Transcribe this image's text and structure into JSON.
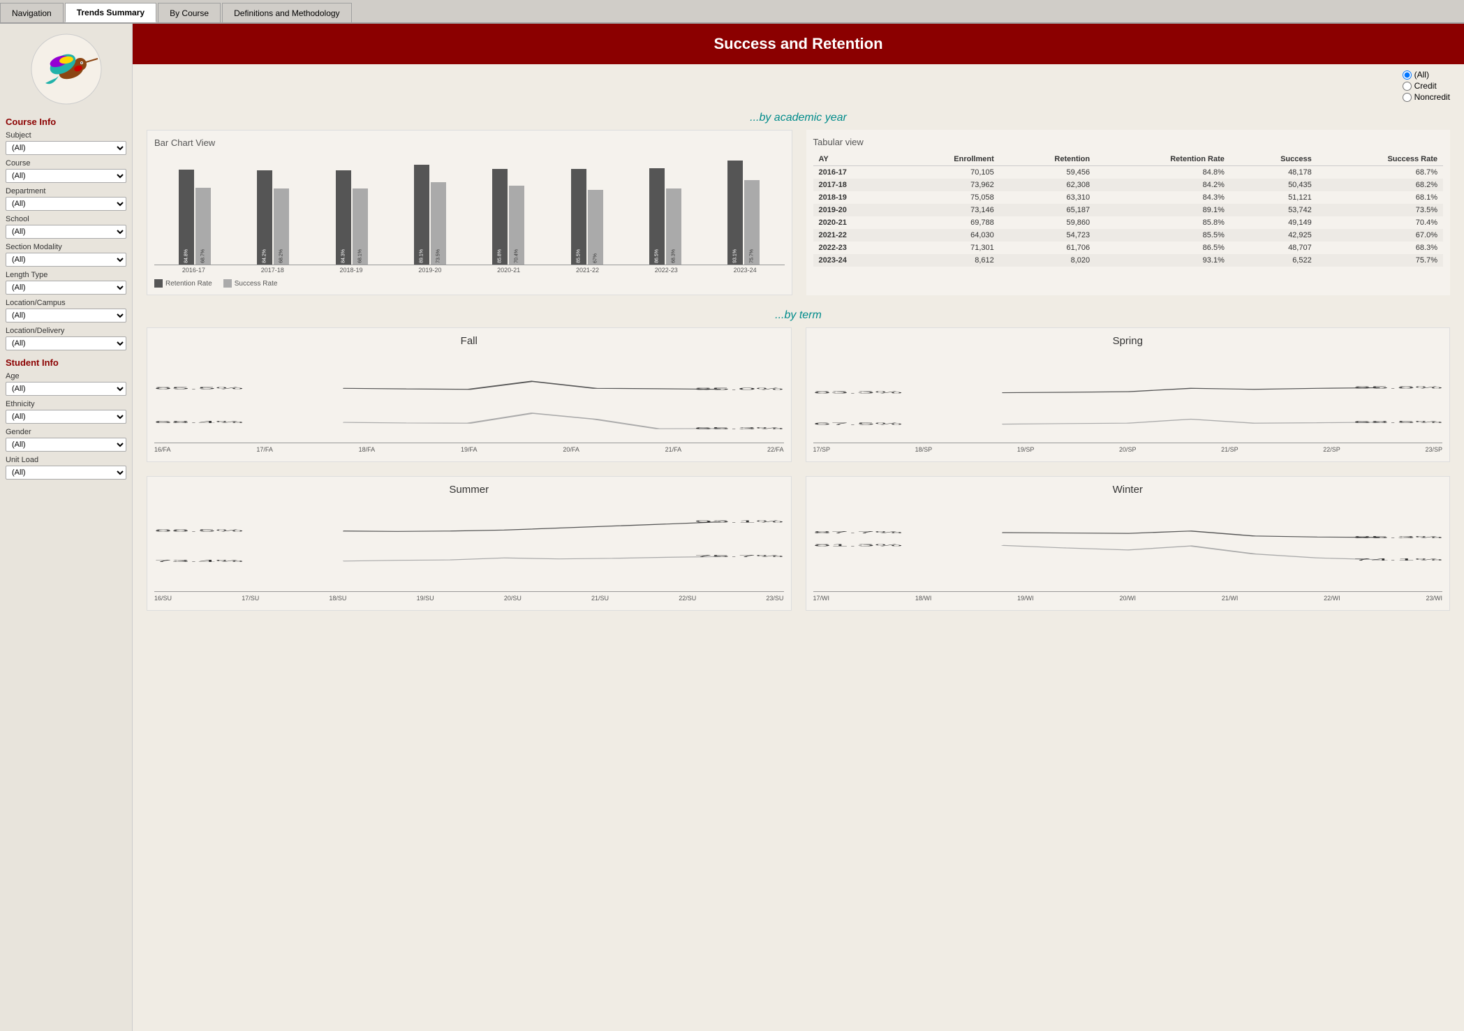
{
  "tabs": [
    {
      "label": "Navigation",
      "active": false
    },
    {
      "label": "Trends Summary",
      "active": true
    },
    {
      "label": "By Course",
      "active": false
    },
    {
      "label": "Definitions and Methodology",
      "active": false
    }
  ],
  "header": {
    "title": "Success and Retention"
  },
  "filter": {
    "options": [
      "(All)",
      "Credit",
      "Noncredit"
    ],
    "selected": "(All)"
  },
  "sidebar": {
    "course_info_title": "Course Info",
    "student_info_title": "Student Info",
    "filters": [
      {
        "label": "Subject",
        "default": "(All)"
      },
      {
        "label": "Course",
        "default": "(All)"
      },
      {
        "label": "Department",
        "default": "(All)"
      },
      {
        "label": "School",
        "default": "(All)"
      },
      {
        "label": "Section Modality",
        "default": "(All)"
      },
      {
        "label": "Length Type",
        "default": "(All)"
      },
      {
        "label": "Location/Campus",
        "default": "(All)"
      },
      {
        "label": "Location/Delivery",
        "default": "(All)"
      }
    ],
    "student_filters": [
      {
        "label": "Age",
        "default": "(All)"
      },
      {
        "label": "Ethnicity",
        "default": "(All)"
      },
      {
        "label": "Gender",
        "default": "(All)"
      },
      {
        "label": "Unit Load",
        "default": "(All)"
      }
    ]
  },
  "by_academic_year": {
    "section_title": "...by academic year",
    "bar_chart_title": "Bar Chart View",
    "tabular_title": "Tabular view",
    "years": [
      "2016-17",
      "2017-18",
      "2018-19",
      "2019-20",
      "2020-21",
      "2021-22",
      "2022-23",
      "2023-24"
    ],
    "retention_rates": [
      84.8,
      84.2,
      84.3,
      89.1,
      85.8,
      85.5,
      86.5,
      93.1
    ],
    "success_rates": [
      68.7,
      68.2,
      68.1,
      73.5,
      70.4,
      67.0,
      68.3,
      75.7
    ],
    "table_rows": [
      {
        "ay": "2016-17",
        "enrollment": "70,105",
        "retention": "59,456",
        "retention_rate": "84.8%",
        "success": "48,178",
        "success_rate": "68.7%"
      },
      {
        "ay": "2017-18",
        "enrollment": "73,962",
        "retention": "62,308",
        "retention_rate": "84.2%",
        "success": "50,435",
        "success_rate": "68.2%"
      },
      {
        "ay": "2018-19",
        "enrollment": "75,058",
        "retention": "63,310",
        "retention_rate": "84.3%",
        "success": "51,121",
        "success_rate": "68.1%"
      },
      {
        "ay": "2019-20",
        "enrollment": "73,146",
        "retention": "65,187",
        "retention_rate": "89.1%",
        "success": "53,742",
        "success_rate": "73.5%"
      },
      {
        "ay": "2020-21",
        "enrollment": "69,788",
        "retention": "59,860",
        "retention_rate": "85.8%",
        "success": "49,149",
        "success_rate": "70.4%"
      },
      {
        "ay": "2021-22",
        "enrollment": "64,030",
        "retention": "54,723",
        "retention_rate": "85.5%",
        "success": "42,925",
        "success_rate": "67.0%"
      },
      {
        "ay": "2022-23",
        "enrollment": "71,301",
        "retention": "61,706",
        "retention_rate": "86.5%",
        "success": "48,707",
        "success_rate": "68.3%"
      },
      {
        "ay": "2023-24",
        "enrollment": "8,612",
        "retention": "8,020",
        "retention_rate": "93.1%",
        "success": "6,522",
        "success_rate": "75.7%"
      }
    ],
    "table_headers": [
      "AY",
      "Enrollment",
      "Retention",
      "Retention Rate",
      "Success",
      "Success Rate"
    ]
  },
  "by_term": {
    "section_title": "...by term",
    "fall": {
      "title": "Fall",
      "labels": [
        "16/FA",
        "17/FA",
        "18/FA",
        "19/FA",
        "20/FA",
        "21/FA",
        "22/FA"
      ],
      "retention": [
        85.5,
        85.2,
        85.0,
        89.0,
        85.5,
        85.3,
        85.0
      ],
      "success": [
        68.4,
        68.1,
        68.0,
        73.0,
        70.0,
        65.2,
        65.3
      ],
      "start_retention": "85.5%",
      "end_retention": "85.0%",
      "start_success": "68.4%",
      "end_success": "65.3%"
    },
    "spring": {
      "title": "Spring",
      "labels": [
        "17/SP",
        "18/SP",
        "19/SP",
        "20/SP",
        "21/SP",
        "22/SP",
        "23/SP"
      ],
      "retention": [
        83.3,
        83.5,
        83.8,
        85.5,
        85.0,
        85.5,
        85.8
      ],
      "success": [
        67.5,
        67.8,
        68.0,
        70.0,
        68.0,
        68.2,
        68.5
      ],
      "start_retention": "83.3%",
      "end_retention": "85.8%",
      "start_success": "67.5%",
      "end_success": "68.5%"
    },
    "summer": {
      "title": "Summer",
      "labels": [
        "16/SU",
        "17/SU",
        "18/SU",
        "19/SU",
        "20/SU",
        "21/SU",
        "22/SU",
        "23/SU"
      ],
      "retention": [
        88.5,
        88.3,
        88.5,
        89.0,
        90.0,
        91.0,
        92.0,
        93.1
      ],
      "success": [
        73.4,
        73.8,
        74.0,
        75.0,
        74.5,
        74.8,
        75.3,
        75.7
      ],
      "start_retention": "88.5%",
      "end_retention": "93.1%",
      "start_success": "73.4%",
      "end_success": "75.7%"
    },
    "winter": {
      "title": "Winter",
      "labels": [
        "17/WI",
        "18/WI",
        "19/WI",
        "20/WI",
        "21/WI",
        "22/WI",
        "23/WI"
      ],
      "retention": [
        87.7,
        87.5,
        87.3,
        88.5,
        86.0,
        85.5,
        85.3
      ],
      "success": [
        81.3,
        80.0,
        79.0,
        81.0,
        77.0,
        75.0,
        74.1
      ],
      "start_retention": "87.7%",
      "end_retention": "85.3%",
      "start_success": "81.3%",
      "end_success": "74.1%"
    }
  },
  "legend": {
    "retention_label": "Retention Rate",
    "success_label": "Success Rate"
  }
}
